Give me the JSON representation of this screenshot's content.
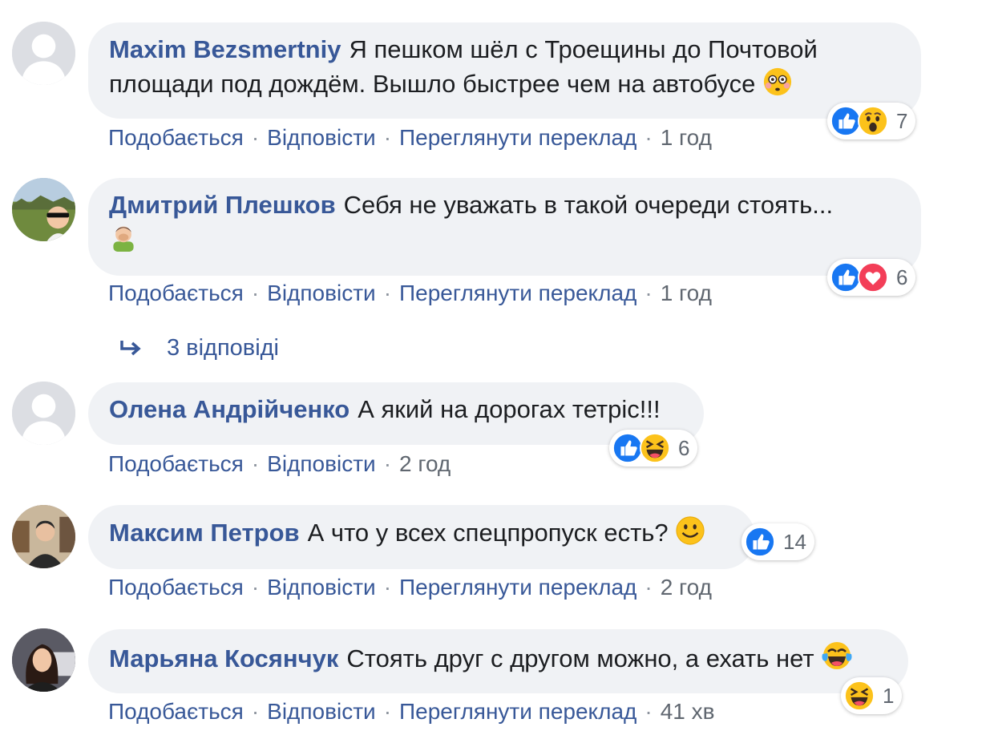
{
  "actions": {
    "like": "Подобається",
    "reply": "Відповісти",
    "translate": "Переглянути переклад",
    "separator": "·"
  },
  "colors": {
    "link": "#385898",
    "bubble": "#f0f2f5",
    "like": "#1877f2",
    "love": "#f33e58",
    "emoji": "#fcc21b"
  },
  "comments": [
    {
      "author": "Maxim Bezsmertniy",
      "text_line1": "Я пешком шёл с Троещины до Почтовой",
      "text_line2": "площади под дождём. Вышло быстрее чем на автобусе",
      "emoji": "flushed-face",
      "time": "1 год",
      "reactions": [
        "like",
        "wow"
      ],
      "reaction_count": "7",
      "avatar": "default-silhouette"
    },
    {
      "author": "Дмитрий Плешков",
      "text_line1": "Себя не уважать в такой очереди стоять...",
      "emoji": "man-facepalming",
      "time": "1 год",
      "reactions": [
        "like",
        "love"
      ],
      "reaction_count": "6",
      "avatar": "photo-man-sunglasses"
    },
    {
      "author": "Олена Андрійченко",
      "text_line1": "А який на дорогах тетріс!!!",
      "time": "2 год",
      "reactions": [
        "like",
        "haha"
      ],
      "reaction_count": "6",
      "avatar": "default-silhouette"
    },
    {
      "author": "Максим Петров",
      "text_line1": "А что у всех спецпропуск есть?",
      "emoji": "smiling-face",
      "time": "2 год",
      "reactions": [
        "like"
      ],
      "reaction_count": "14",
      "avatar": "photo-man-city"
    },
    {
      "author": "Марьяна Косянчук",
      "text_line1": "Стоять друг с другом можно, а ехать нет",
      "emoji": "tears-of-joy",
      "time": "41 хв",
      "reactions": [
        "haha"
      ],
      "reaction_count": "1",
      "avatar": "photo-woman"
    }
  ],
  "replies_link": "3 відповіді"
}
